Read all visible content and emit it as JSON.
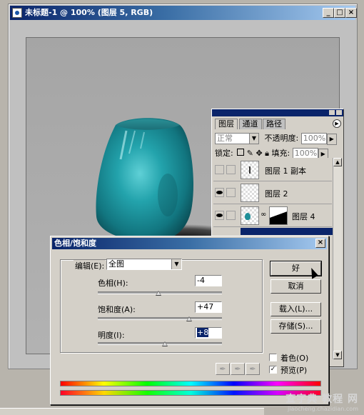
{
  "document": {
    "title": "未标题-1 @ 100% (图层 5, RGB)",
    "window_buttons": {
      "minimize": "_",
      "maximize": "□",
      "close": "×"
    }
  },
  "layers_panel": {
    "tabs": [
      "图层",
      "通道",
      "路径"
    ],
    "blend_mode": "正常",
    "opacity_label": "不透明度:",
    "opacity_value": "100%",
    "lock_label": "锁定:",
    "fill_label": "填充:",
    "fill_value": "100%",
    "layers": [
      {
        "name": "图层 1 副本",
        "visible": false
      },
      {
        "name": "图层 2",
        "visible": true
      },
      {
        "name": "图层 4",
        "visible": true
      }
    ]
  },
  "dialog": {
    "title": "色相/饱和度",
    "edit_label": "编辑(E):",
    "edit_value": "全图",
    "hue_label": "色相(H):",
    "hue_value": "-4",
    "saturation_label": "饱和度(A):",
    "saturation_value": "+47",
    "lightness_label": "明度(I):",
    "lightness_value": "+8",
    "slider_levels": {
      "hue": -4,
      "saturation": 47,
      "lightness": 8
    },
    "buttons": {
      "ok": "好",
      "cancel": "取消",
      "load": "载入(L)...",
      "save": "存储(S)..."
    },
    "colorize_label": "着色(O)",
    "colorize_checked": false,
    "preview_label": "预览(P)",
    "preview_checked": true,
    "close": "×"
  },
  "watermark": {
    "line1": "查字典 教程 网",
    "line2": "jiaocheng.chazidian.com"
  },
  "colors": {
    "title_dark": "#0a246a",
    "title_light": "#a6caf0",
    "vase": "#1e8f98",
    "dialog_bg": "#d4d0c8"
  }
}
